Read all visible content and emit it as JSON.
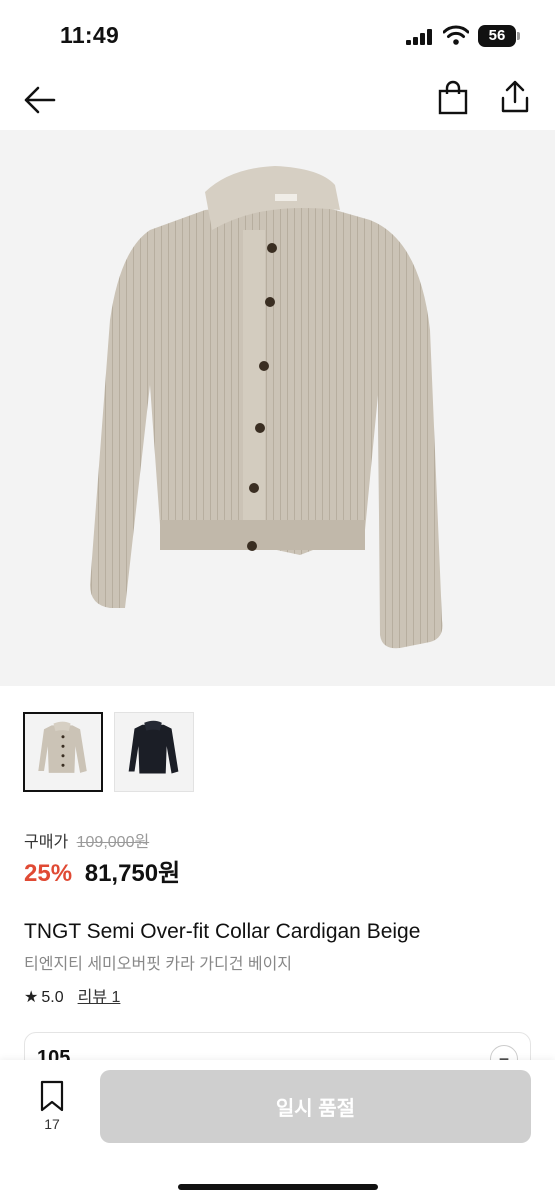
{
  "status": {
    "time": "11:49",
    "battery": "56"
  },
  "gallery": {
    "thumbnails": [
      {
        "label": "beige-cardigan",
        "color": "#cbc3b6"
      },
      {
        "label": "black-cardigan",
        "color": "#1b1e26"
      }
    ]
  },
  "product": {
    "price_label": "구매가",
    "original_price": "109,000원",
    "discount": "25%",
    "final_price": "81,750원",
    "title_en": "TNGT Semi Over-fit Collar Cardigan Beige",
    "title_ko": "티엔지티 세미오버핏 카라 가디건 베이지",
    "rating": "5.0",
    "review_link": "리뷰 1"
  },
  "option": {
    "value": "105",
    "toggle_glyph": "−"
  },
  "bottom": {
    "wishlist_count": "17",
    "buy_label": "일시 품절"
  },
  "colors": {
    "accent_discount": "#e04a34",
    "disabled_button": "#cfcfcf"
  }
}
